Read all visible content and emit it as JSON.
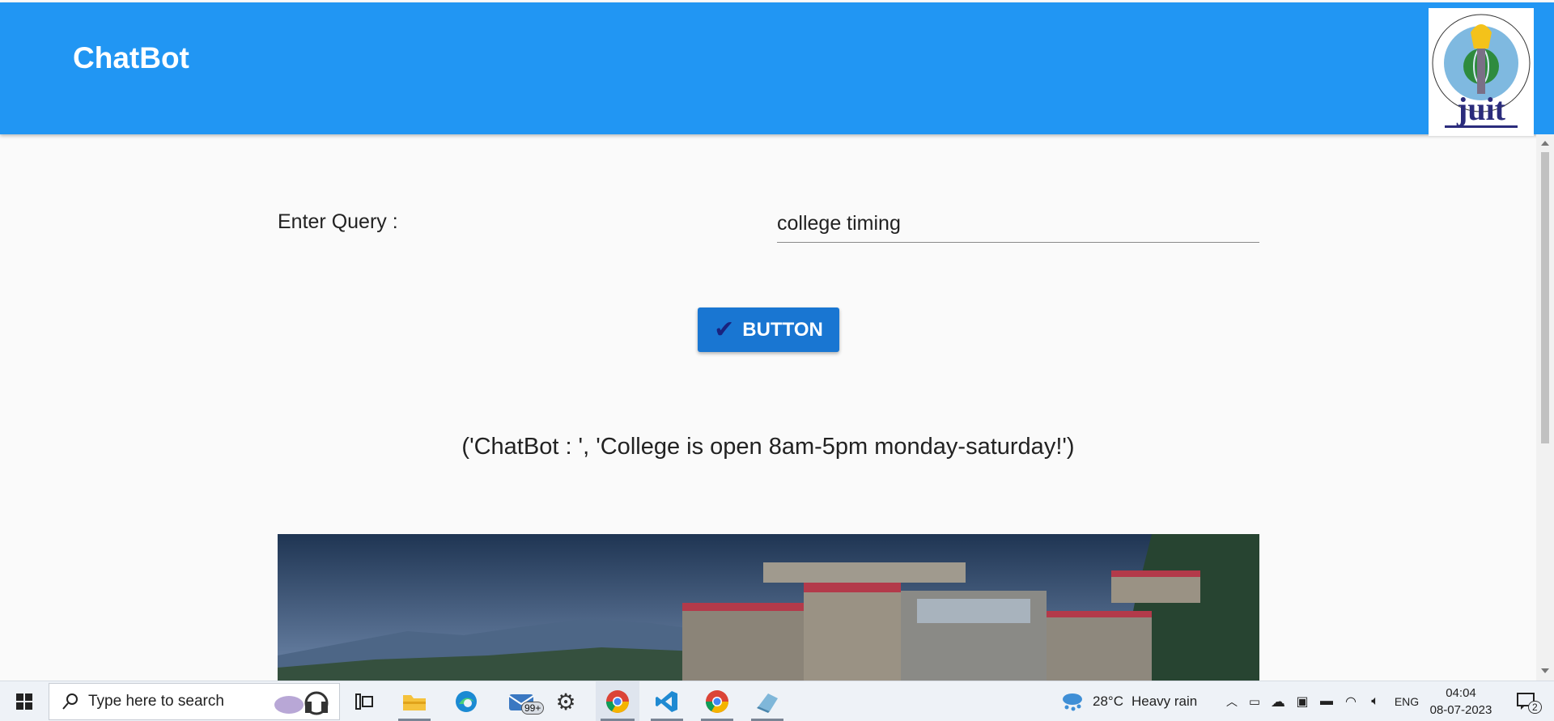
{
  "app": {
    "title": "ChatBot",
    "logo_text": "juit"
  },
  "form": {
    "label": "Enter Query :",
    "query_value": "college timing",
    "button_label": "BUTTON",
    "button_icon": "checkmark-icon"
  },
  "response": "('ChatBot : ', 'College is open 8am-5pm monday-saturday!')",
  "taskbar": {
    "search_placeholder": "Type here to search",
    "mail_badge": "99+",
    "weather_temp": "28°C",
    "weather_desc": "Heavy rain",
    "language": "ENG",
    "time": "04:04",
    "date": "08-07-2023",
    "notification_count": "2"
  },
  "colors": {
    "appbar": "#2196f3",
    "button": "#1976d2",
    "background": "#fafafa"
  }
}
